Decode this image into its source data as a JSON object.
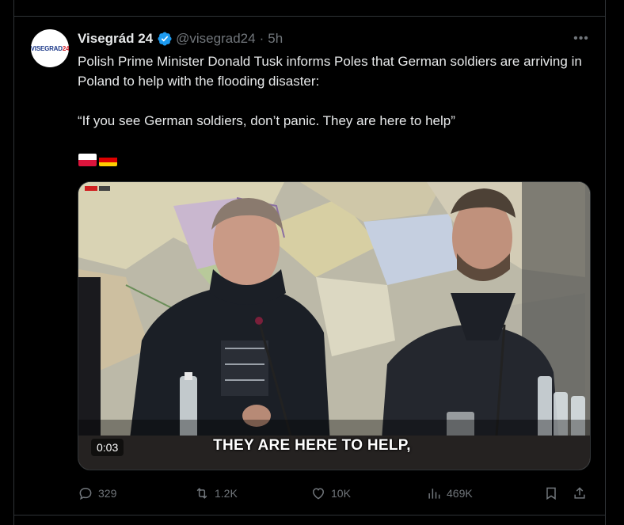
{
  "tweet": {
    "display_name": "Visegrád 24",
    "handle": "@visegrad24",
    "separator": "·",
    "time": "5h",
    "avatar_text_prefix": "VISEGRAD",
    "avatar_text_suffix": "24",
    "text_line1": "Polish Prime Minister Donald Tusk informs Poles that German soldiers are arriving in Poland to help with the flooding disaster:",
    "text_quote": "“If you see German soldiers, don’t panic. They are here to help”",
    "flags": [
      {
        "name": "poland-flag-icon",
        "colors": [
          "#ffffff",
          "#dc143c"
        ]
      },
      {
        "name": "germany-flag-icon",
        "colors": [
          "#000000",
          "#dd0000",
          "#ffce00"
        ]
      }
    ]
  },
  "media": {
    "caption": "THEY ARE HERE TO HELP,",
    "timestamp": "0:03"
  },
  "actions": {
    "replies": "329",
    "reposts": "1.2K",
    "likes": "10K",
    "views": "469K"
  },
  "icons": {
    "more": "more-icon",
    "verified": "verified-badge-icon",
    "reply": "reply-icon",
    "repost": "repost-icon",
    "like": "heart-icon",
    "views": "views-icon",
    "bookmark": "bookmark-icon",
    "share": "share-icon"
  },
  "colors": {
    "background": "#000000",
    "text": "#e7e9ea",
    "muted": "#71767b",
    "verified": "#1d9bf0",
    "border": "#2f3336"
  }
}
